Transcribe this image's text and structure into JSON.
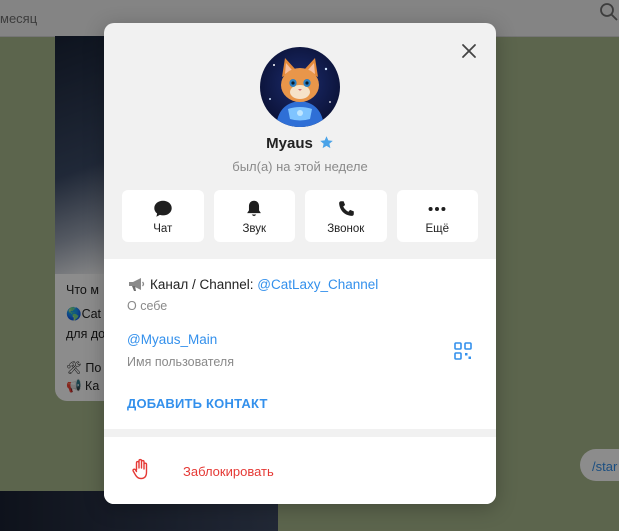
{
  "background": {
    "status_text": "месяц",
    "message_lines": [
      "Что м",
      "🌎Cat",
      "для до",
      "🛠 По",
      "📢 Ка"
    ],
    "command_hint": "/star"
  },
  "profile": {
    "name": "Myaus",
    "last_seen": "был(а) на этой неделе"
  },
  "actions": [
    {
      "label": "Чат",
      "icon": "chat-bubble-icon"
    },
    {
      "label": "Звук",
      "icon": "bell-icon"
    },
    {
      "label": "Звонок",
      "icon": "phone-icon"
    },
    {
      "label": "Ещё",
      "icon": "more-dots-icon"
    }
  ],
  "bio": {
    "prefix": "Канал / Channel: ",
    "link": "@CatLaxy_Channel",
    "caption": "О себе"
  },
  "username": {
    "value": "@Myaus_Main",
    "caption": "Имя пользователя"
  },
  "add_contact_label": "ДОБАВИТЬ КОНТАКТ",
  "block_label": "Заблокировать",
  "colors": {
    "accent": "#3390ec",
    "danger": "#e53935",
    "premium_star": "#4aa3e8"
  }
}
